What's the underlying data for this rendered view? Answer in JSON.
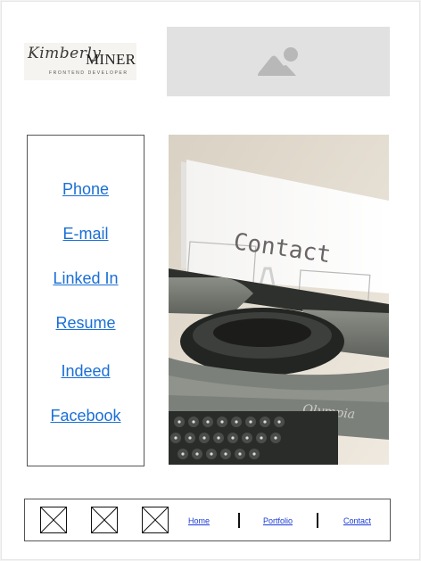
{
  "header": {
    "logo_script": "Kimberly",
    "logo_name": "MINER",
    "logo_tagline": "FRONTEND DEVELOPER",
    "image_placeholder_icon": "image-placeholder-icon"
  },
  "contact_links": [
    {
      "label": "Phone"
    },
    {
      "label": "E-mail"
    },
    {
      "label": "Linked In"
    },
    {
      "label": "Resume"
    },
    {
      "label": "Indeed"
    },
    {
      "label": "Facebook"
    }
  ],
  "photo": {
    "paper_text": "Contact",
    "brand_text": "Olympia"
  },
  "footer": {
    "social_icons": [
      "social-icon-placeholder",
      "social-icon-placeholder",
      "social-icon-placeholder"
    ],
    "nav": [
      {
        "label": "Home"
      },
      {
        "label": "Portfolio"
      },
      {
        "label": "Contact"
      }
    ]
  },
  "colors": {
    "link": "#1a6fd6",
    "footer_link": "#1a3ad6",
    "placeholder_bg": "#e1e1e1",
    "placeholder_icon": "#b8b8b8"
  }
}
